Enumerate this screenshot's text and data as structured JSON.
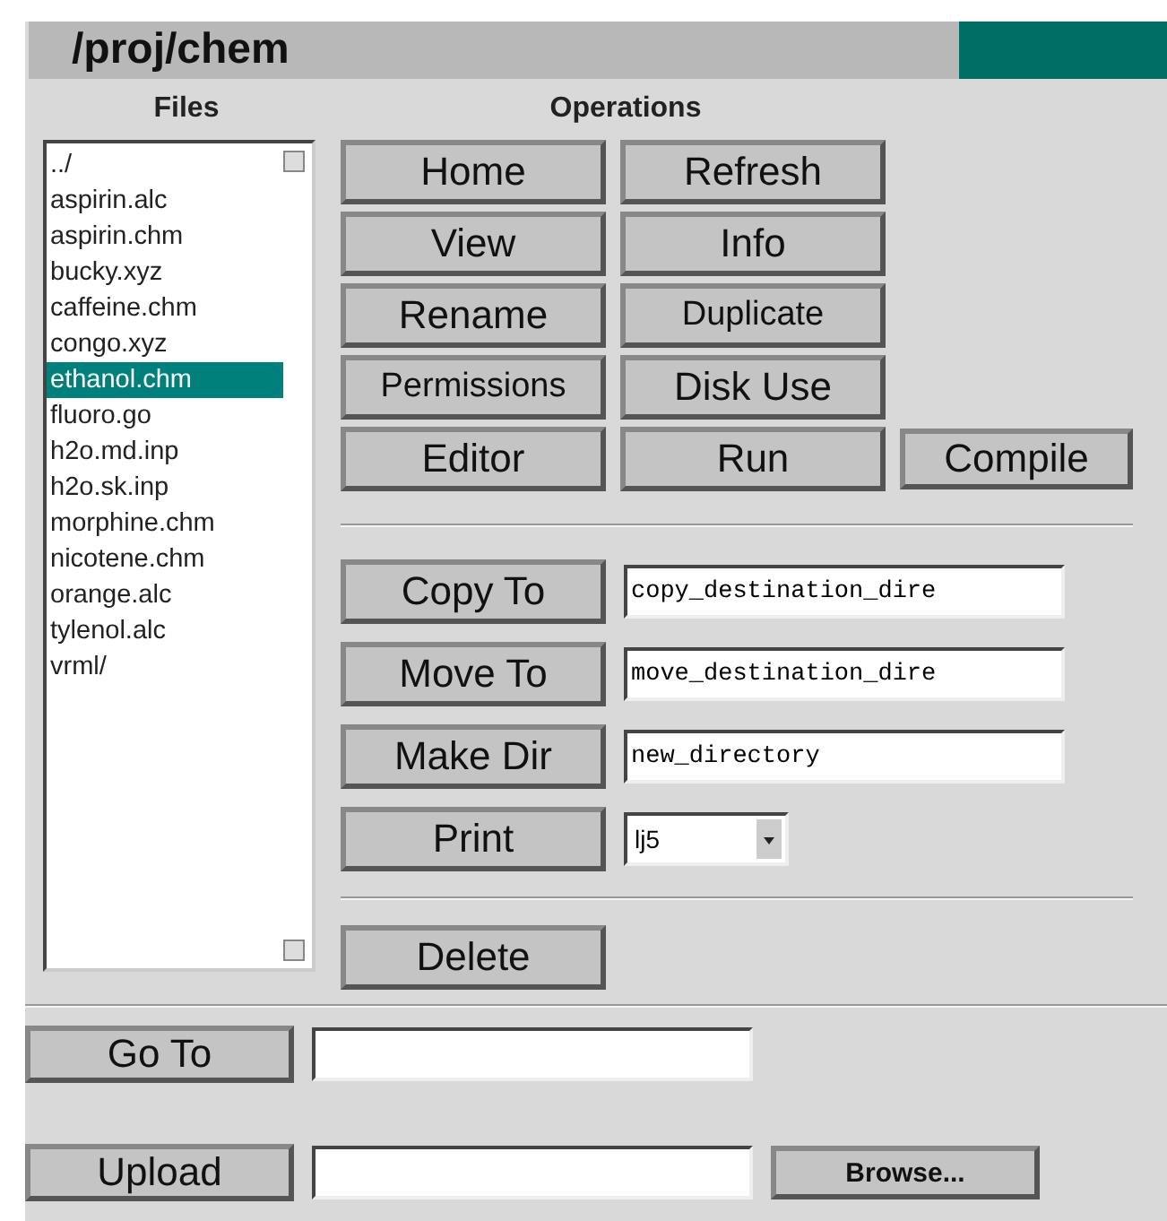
{
  "title": "/proj/chem",
  "files": {
    "heading": "Files",
    "items": [
      {
        "name": "../",
        "selected": false
      },
      {
        "name": "aspirin.alc",
        "selected": false
      },
      {
        "name": "aspirin.chm",
        "selected": false
      },
      {
        "name": "bucky.xyz",
        "selected": false
      },
      {
        "name": "caffeine.chm",
        "selected": false
      },
      {
        "name": "congo.xyz",
        "selected": false
      },
      {
        "name": "ethanol.chm",
        "selected": true
      },
      {
        "name": "fluoro.go",
        "selected": false
      },
      {
        "name": "h2o.md.inp",
        "selected": false
      },
      {
        "name": "h2o.sk.inp",
        "selected": false
      },
      {
        "name": "morphine.chm",
        "selected": false
      },
      {
        "name": "nicotene.chm",
        "selected": false
      },
      {
        "name": "orange.alc",
        "selected": false
      },
      {
        "name": "tylenol.alc",
        "selected": false
      },
      {
        "name": "vrml/",
        "selected": false
      }
    ]
  },
  "operations": {
    "heading": "Operations",
    "rows": [
      [
        "Home",
        "Refresh"
      ],
      [
        "View",
        "Info"
      ],
      [
        "Rename",
        "Duplicate"
      ],
      [
        "Permissions",
        "Disk Use"
      ],
      [
        "Editor",
        "Run",
        "Compile"
      ]
    ]
  },
  "targets": [
    {
      "kind": "text",
      "button": "Copy To",
      "value": "copy_destination_dire"
    },
    {
      "kind": "text",
      "button": "Move To",
      "value": "move_destination_dire"
    },
    {
      "kind": "text",
      "button": "Make Dir",
      "value": "new_directory"
    },
    {
      "kind": "select",
      "button": "Print",
      "value": "lj5"
    }
  ],
  "delete_button": "Delete",
  "goto": {
    "button": "Go To"
  },
  "upload": {
    "button": "Upload",
    "browse": "Browse..."
  }
}
